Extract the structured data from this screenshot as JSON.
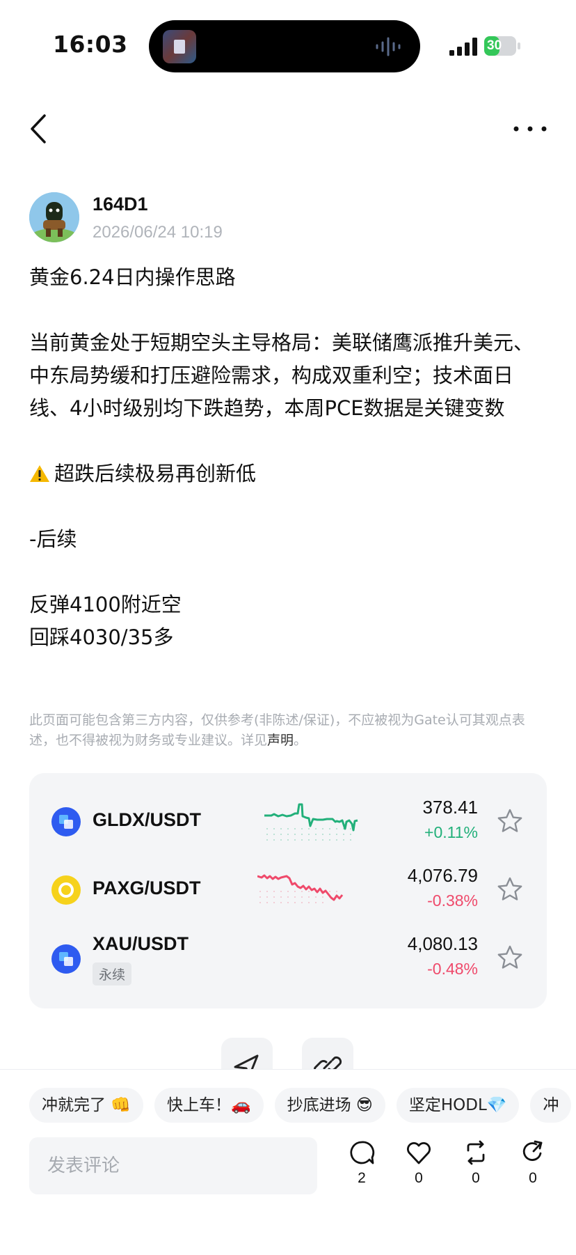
{
  "status_bar": {
    "time": "16:03",
    "battery": "30"
  },
  "author": {
    "name": "164D1",
    "timestamp": "2026/06/24 10:19"
  },
  "post": {
    "title": "黄金6.24日内操作思路",
    "paragraph1": "当前黄金处于短期空头主导格局：美联储鹰派推升美元、中东局势缓和打压避险需求，构成双重利空；技术面日线、4小时级别均下跌趋势，本周PCE数据是关键变数",
    "warning": "超跌后续极易再创新低",
    "section": "-后续",
    "line1": "反弹4100附近空",
    "line2": "回踩4030/35多"
  },
  "disclaimer": {
    "text": "此页面可能包含第三方内容，仅供参考(非陈述/保证)，不应被视为Gate认可其观点表述，也不得被视为财务或专业建议。详见",
    "link": "声明",
    "end": "。"
  },
  "markets": [
    {
      "pair": "GLDX/USDT",
      "price": "378.41",
      "change": "+0.11%",
      "trend": "up",
      "icon": "gate-token-icon"
    },
    {
      "pair": "PAXG/USDT",
      "price": "4,076.79",
      "change": "-0.38%",
      "trend": "down",
      "icon": "paxg-icon"
    },
    {
      "pair": "XAU/USDT",
      "tag": "永续",
      "price": "4,080.13",
      "change": "-0.48%",
      "trend": "down",
      "icon": "gate-token-icon"
    }
  ],
  "chips": [
    "冲就完了 👊",
    "快上车！🚗",
    "抄底进场 😎",
    "坚定HODL💎",
    "冲"
  ],
  "comment": {
    "placeholder": "发表评论"
  },
  "actions": {
    "comments": "2",
    "likes": "0",
    "reposts": "0",
    "shares": "0"
  },
  "colors": {
    "up": "#22b07a",
    "down": "#ef4a6b"
  }
}
